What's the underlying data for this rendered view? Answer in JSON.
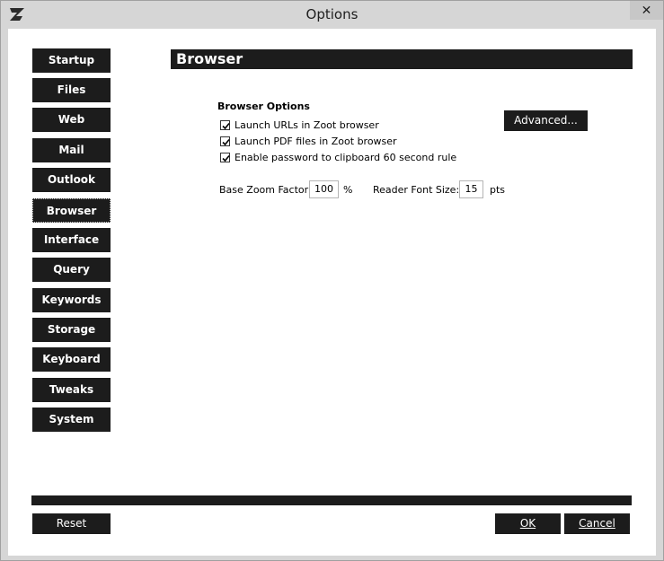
{
  "window": {
    "title": "Options",
    "close_glyph": "✕"
  },
  "nav": {
    "items": [
      {
        "label": "Startup"
      },
      {
        "label": "Files"
      },
      {
        "label": "Web"
      },
      {
        "label": "Mail"
      },
      {
        "label": "Outlook"
      },
      {
        "label": "Browser",
        "active": true
      },
      {
        "label": "Interface"
      },
      {
        "label": "Query"
      },
      {
        "label": "Keywords"
      },
      {
        "label": "Storage"
      },
      {
        "label": "Keyboard"
      },
      {
        "label": "Tweaks"
      },
      {
        "label": "System"
      }
    ]
  },
  "section": {
    "title": "Browser"
  },
  "browser_options": {
    "group_label": "Browser Options",
    "options": [
      {
        "label": "Launch URLs in Zoot browser",
        "checked": true
      },
      {
        "label": "Launch PDF files in Zoot browser",
        "checked": true
      },
      {
        "label": "Enable password to clipboard 60 second rule",
        "checked": true
      }
    ],
    "advanced_label": "Advanced..."
  },
  "zoom": {
    "label": "Base Zoom Factor:",
    "value": "100",
    "unit": "%"
  },
  "font": {
    "label": "Reader Font Size:",
    "value": "15",
    "unit": "pts"
  },
  "footer": {
    "reset_label": "Reset",
    "ok_label": "OK",
    "cancel_label": "Cancel"
  },
  "colors": {
    "button_bg": "#1c1c1c",
    "frame": "#d6d6d6"
  }
}
